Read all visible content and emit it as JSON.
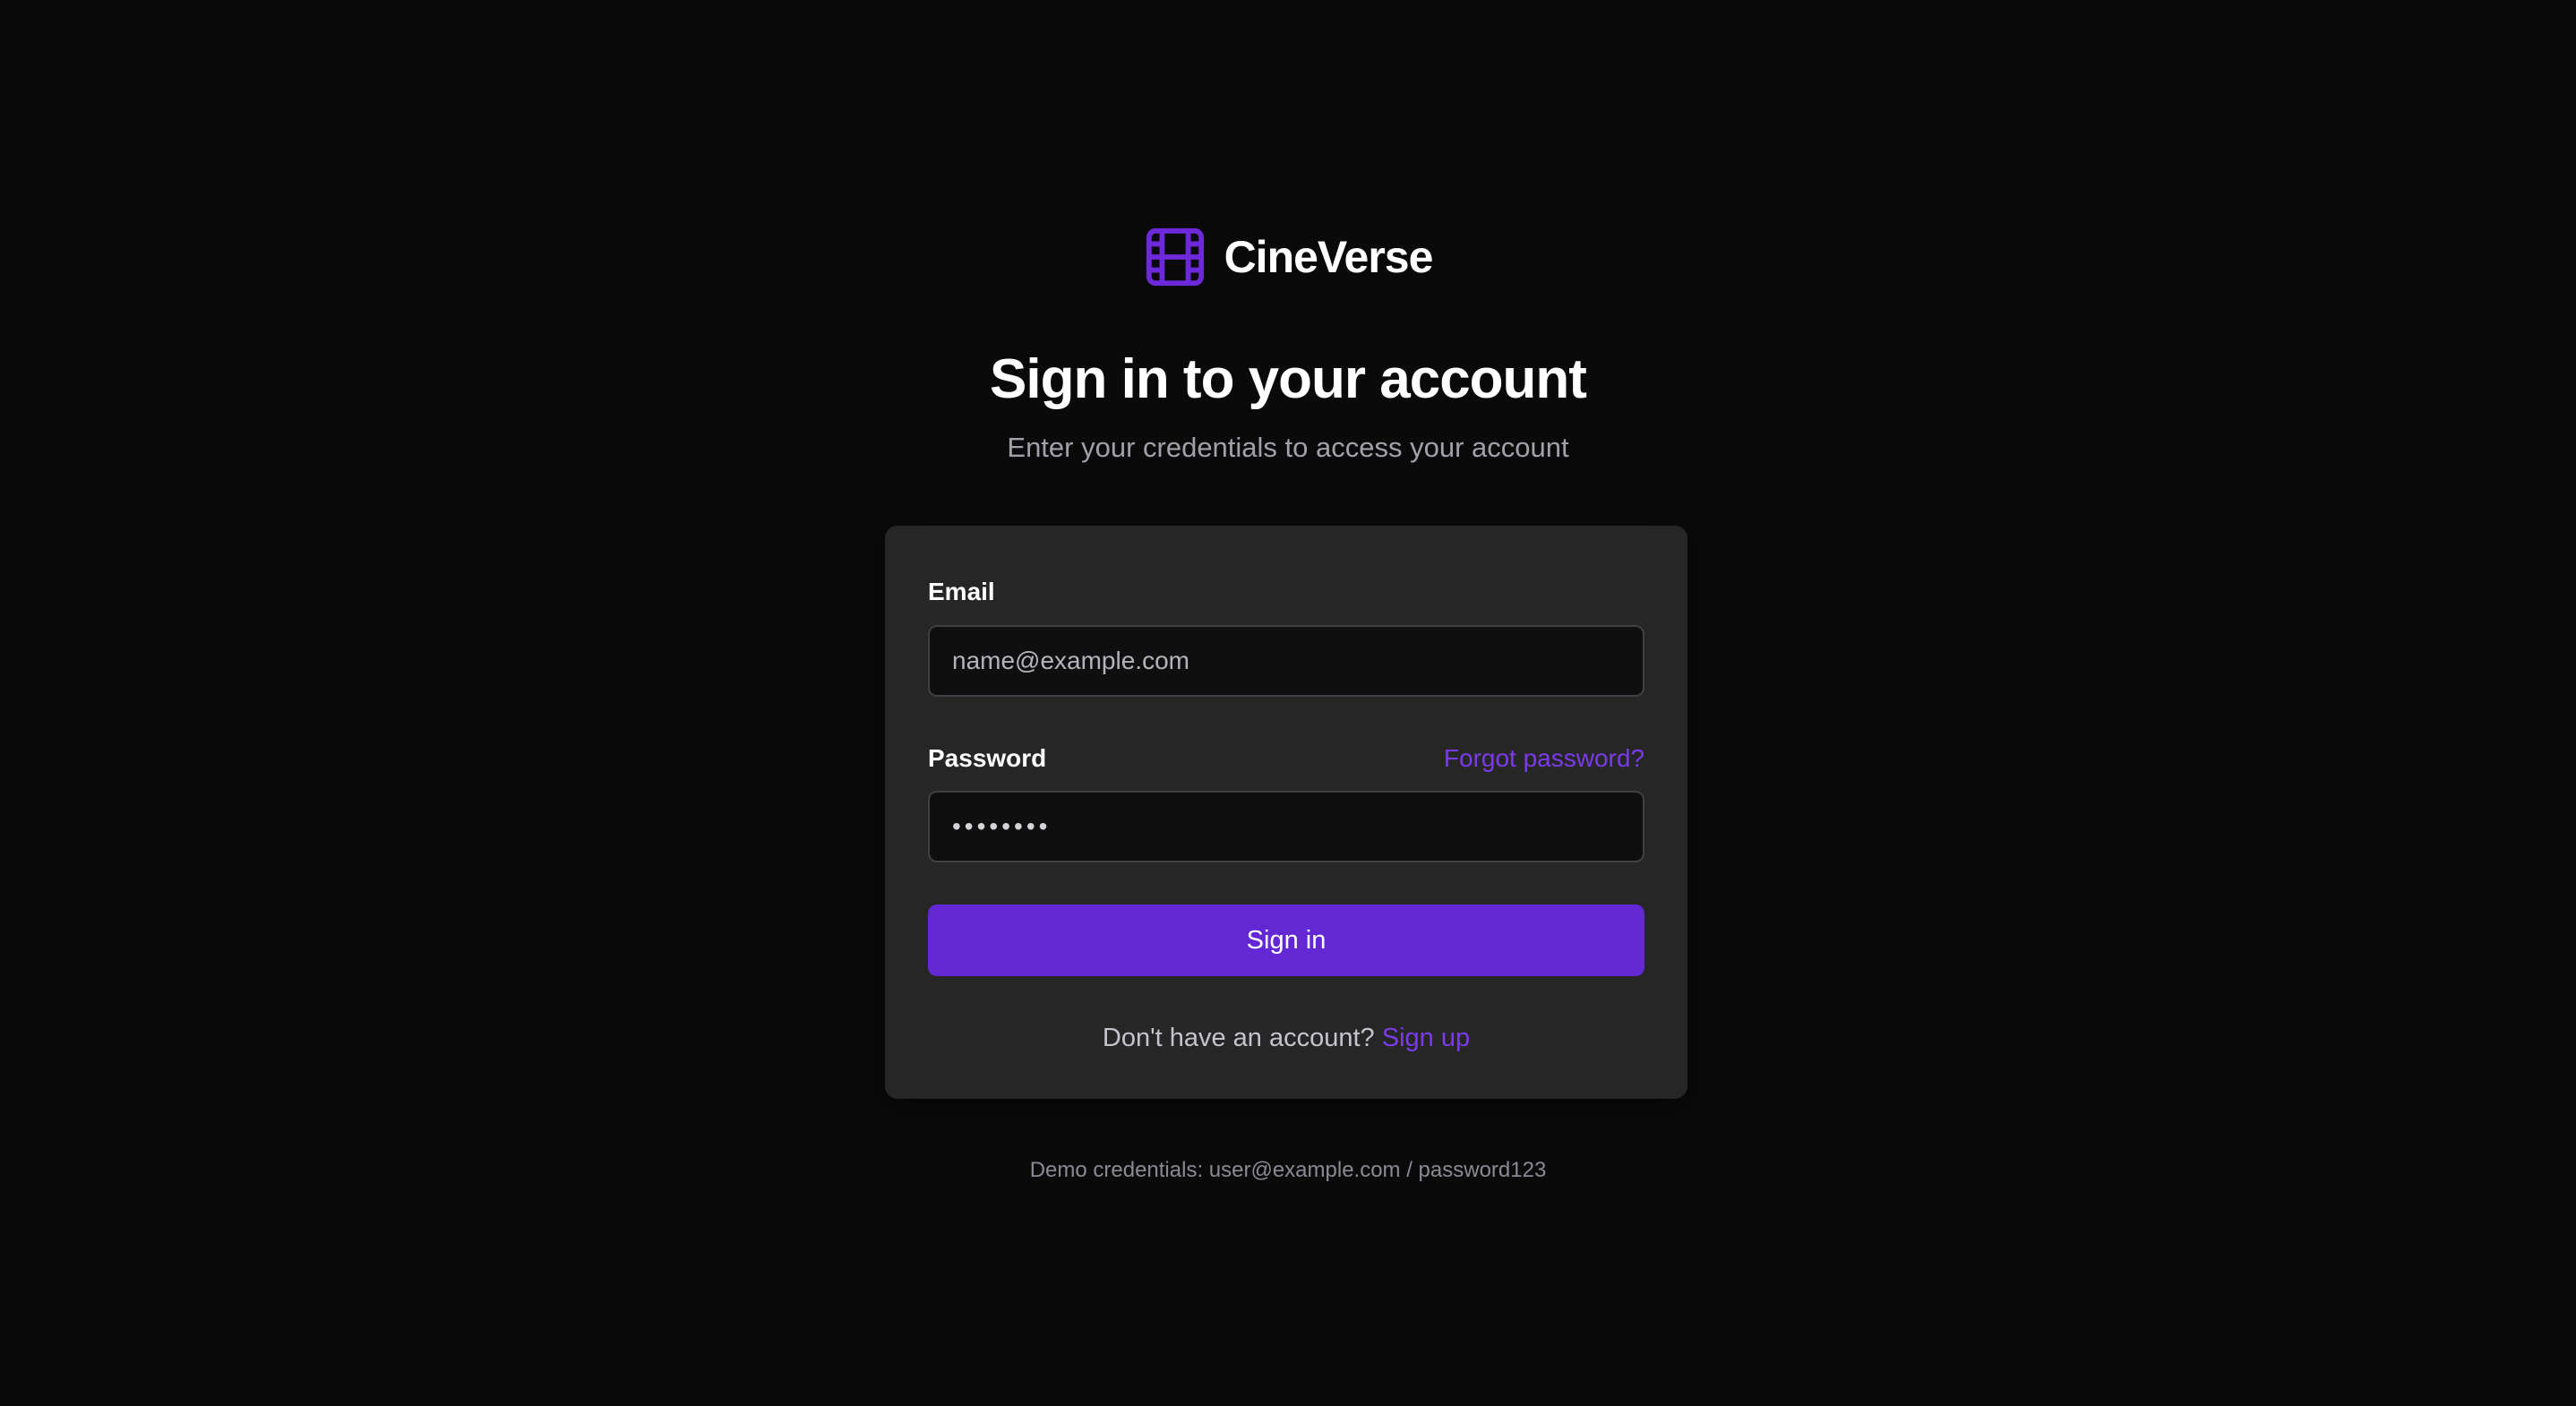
{
  "brand": {
    "name": "CineVerse",
    "icon": "film-icon",
    "accent_color": "#6d28d9"
  },
  "heading": {
    "title": "Sign in to your account",
    "subtitle": "Enter your credentials to access your account"
  },
  "form": {
    "email": {
      "label": "Email",
      "placeholder": "name@example.com",
      "value": ""
    },
    "password": {
      "label": "Password",
      "value": "password",
      "forgot_label": "Forgot password?"
    },
    "submit_label": "Sign in",
    "signup": {
      "prompt": "Don't have an account?",
      "link_label": "Sign up"
    }
  },
  "footer": {
    "demo_text": "Demo credentials: user@example.com / password123"
  },
  "colors": {
    "background": "#0a0a0a",
    "card": "#262626",
    "primary_button": "#6328d4",
    "link": "#7c3aed"
  }
}
